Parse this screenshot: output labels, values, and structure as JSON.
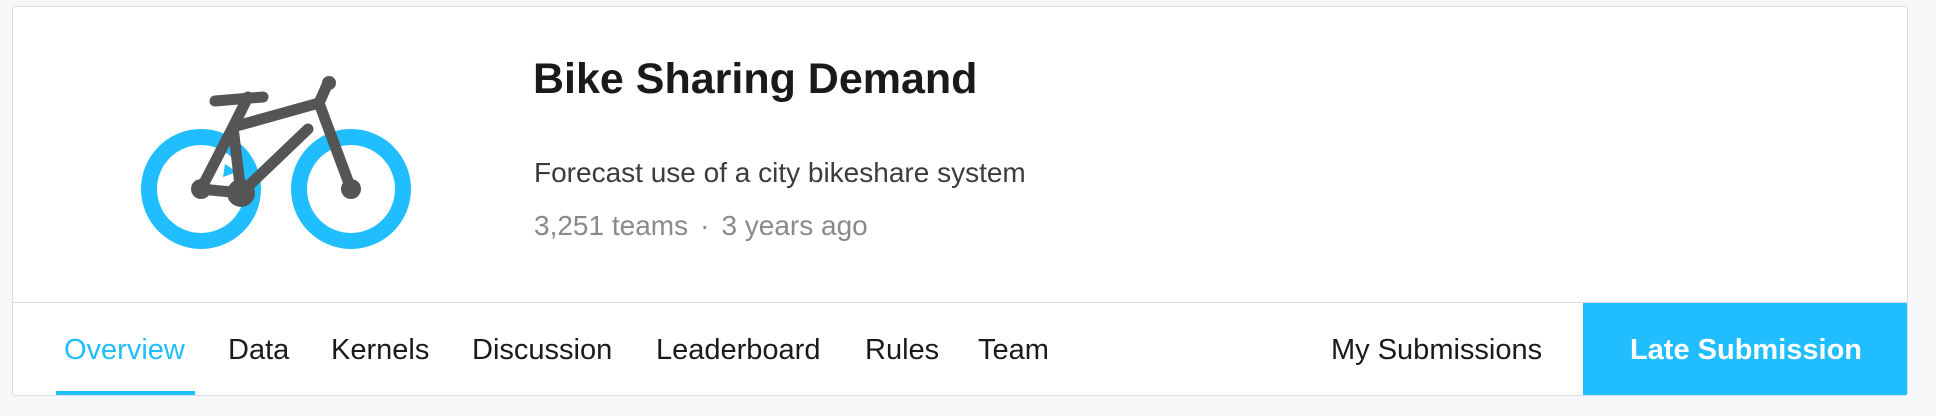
{
  "competition": {
    "title": "Bike Sharing Demand",
    "subtitle": "Forecast use of a city bikeshare system",
    "teams": "3,251 teams",
    "separator": "·",
    "age": "3 years ago",
    "logo_icon": "bicycle-icon"
  },
  "tabs": [
    {
      "label": "Overview",
      "active": true
    },
    {
      "label": "Data",
      "active": false
    },
    {
      "label": "Kernels",
      "active": false
    },
    {
      "label": "Discussion",
      "active": false
    },
    {
      "label": "Leaderboard",
      "active": false
    },
    {
      "label": "Rules",
      "active": false
    },
    {
      "label": "Team",
      "active": false
    }
  ],
  "actions": {
    "my_submissions": "My Submissions",
    "late_submission": "Late Submission"
  },
  "colors": {
    "accent": "#20beff",
    "bike_frame": "#555555",
    "text": "#1a1a1a",
    "muted": "#8a8a8a"
  }
}
